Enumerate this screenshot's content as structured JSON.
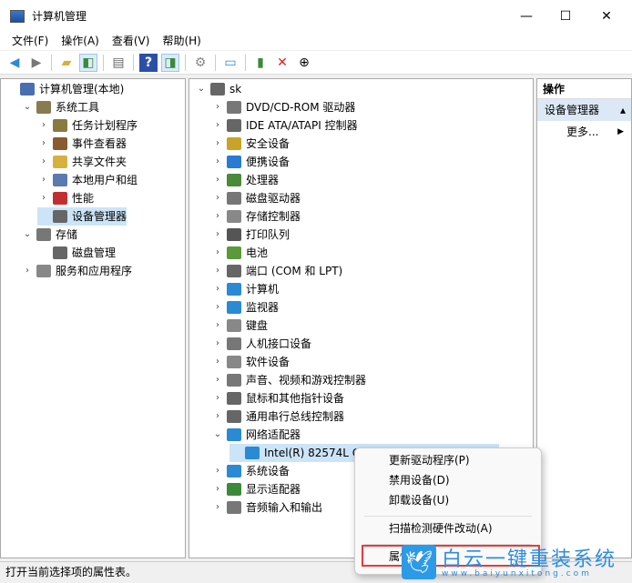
{
  "window": {
    "title": "计算机管理",
    "minimize": "—",
    "maximize": "☐",
    "close": "✕"
  },
  "menu": [
    "文件(F)",
    "操作(A)",
    "查看(V)",
    "帮助(H)"
  ],
  "toolbar_icons": [
    "back-icon",
    "forward-icon",
    "up-folder-icon",
    "show-hide-tree-icon",
    "properties-icon",
    "help-icon",
    "show-action-pane-icon",
    "update-driver-icon",
    "scan-hardware-icon",
    "enable-device-icon",
    "uninstall-icon",
    "disable-icon"
  ],
  "left_tree": [
    {
      "label": "计算机管理(本地)",
      "level": 0,
      "exp": ""
    },
    {
      "label": "系统工具",
      "level": 1,
      "exp": "⌄"
    },
    {
      "label": "任务计划程序",
      "level": 2,
      "exp": "›"
    },
    {
      "label": "事件查看器",
      "level": 2,
      "exp": "›"
    },
    {
      "label": "共享文件夹",
      "level": 2,
      "exp": "›"
    },
    {
      "label": "本地用户和组",
      "level": 2,
      "exp": "›"
    },
    {
      "label": "性能",
      "level": 2,
      "exp": "›"
    },
    {
      "label": "设备管理器",
      "level": 2,
      "exp": "",
      "selected": true
    },
    {
      "label": "存储",
      "level": 1,
      "exp": "⌄"
    },
    {
      "label": "磁盘管理",
      "level": 2,
      "exp": ""
    },
    {
      "label": "服务和应用程序",
      "level": 1,
      "exp": "›"
    }
  ],
  "device_tree": {
    "root": "sk",
    "items": [
      {
        "label": "DVD/CD-ROM 驱动器",
        "exp": "›",
        "color": "#777"
      },
      {
        "label": "IDE ATA/ATAPI 控制器",
        "exp": "›",
        "color": "#666"
      },
      {
        "label": "安全设备",
        "exp": "›",
        "color": "#c9a227"
      },
      {
        "label": "便携设备",
        "exp": "›",
        "color": "#2a7bd4"
      },
      {
        "label": "处理器",
        "exp": "›",
        "color": "#4a8a3a"
      },
      {
        "label": "磁盘驱动器",
        "exp": "›",
        "color": "#777"
      },
      {
        "label": "存储控制器",
        "exp": "›",
        "color": "#888"
      },
      {
        "label": "打印队列",
        "exp": "›",
        "color": "#555"
      },
      {
        "label": "电池",
        "exp": "›",
        "color": "#5a9a3a"
      },
      {
        "label": "端口 (COM 和 LPT)",
        "exp": "›",
        "color": "#666"
      },
      {
        "label": "计算机",
        "exp": "›",
        "color": "#2a8ad4"
      },
      {
        "label": "监视器",
        "exp": "›",
        "color": "#2a8ad4"
      },
      {
        "label": "键盘",
        "exp": "›",
        "color": "#888"
      },
      {
        "label": "人机接口设备",
        "exp": "›",
        "color": "#777"
      },
      {
        "label": "软件设备",
        "exp": "›",
        "color": "#888"
      },
      {
        "label": "声音、视频和游戏控制器",
        "exp": "›",
        "color": "#777"
      },
      {
        "label": "鼠标和其他指针设备",
        "exp": "›",
        "color": "#666"
      },
      {
        "label": "通用串行总线控制器",
        "exp": "›",
        "color": "#666"
      },
      {
        "label": "网络适配器",
        "exp": "⌄",
        "color": "#2a8ad4"
      },
      {
        "label": "Intel(R) 82574L Gi",
        "exp": "",
        "color": "#2a8ad4",
        "child": true,
        "selected": true
      },
      {
        "label": "系统设备",
        "exp": "›",
        "color": "#2a8ad4"
      },
      {
        "label": "显示适配器",
        "exp": "›",
        "color": "#3a8a3a"
      },
      {
        "label": "音频输入和输出",
        "exp": "›",
        "color": "#777"
      }
    ]
  },
  "actions": {
    "header": "操作",
    "section": "设备管理器",
    "more": "更多..."
  },
  "context_menu": {
    "items": [
      "更新驱动程序(P)",
      "禁用设备(D)",
      "卸载设备(U)",
      "扫描检测硬件改动(A)",
      "属性"
    ]
  },
  "status": "打开当前选择项的属性表。",
  "watermark": {
    "brand": "白云一键重装系统",
    "url": "www.baiyunxitong.com"
  }
}
